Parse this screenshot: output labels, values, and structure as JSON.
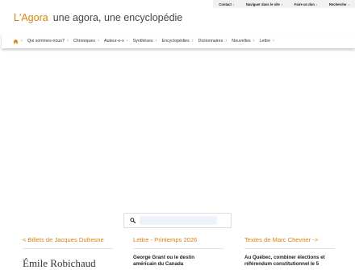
{
  "topnav": {
    "items": [
      "Contact",
      "Naviguer dans le site",
      "Faire un don",
      "Recherche"
    ]
  },
  "brand": {
    "logo": "L'Agora",
    "tagline": "une agora, une encyclopédie"
  },
  "mainnav": {
    "items": [
      "Qui sommes-nous?",
      "Chroniques",
      "Auteur-e-s",
      "Synthèses",
      "Encyclopédies",
      "Dictionnaires",
      "Nouvelles",
      "Lettre"
    ]
  },
  "search": {
    "placeholder": ""
  },
  "columns": {
    "left": {
      "heading": "< Billets de Jacques Dufresne",
      "item_title": "Émile Robichaud"
    },
    "middle": {
      "heading": "Lettre - Printemps 2026",
      "item_title": "George Grant ou le destin américain du Canada"
    },
    "right": {
      "heading": "Textes de Marc Chevrier ->",
      "item_title": "Au Québec, combiner élections et référendum constitutionnel le 5"
    }
  },
  "colors": {
    "accent": "#d4820f",
    "topbar_bg": "#f1f1f1"
  }
}
